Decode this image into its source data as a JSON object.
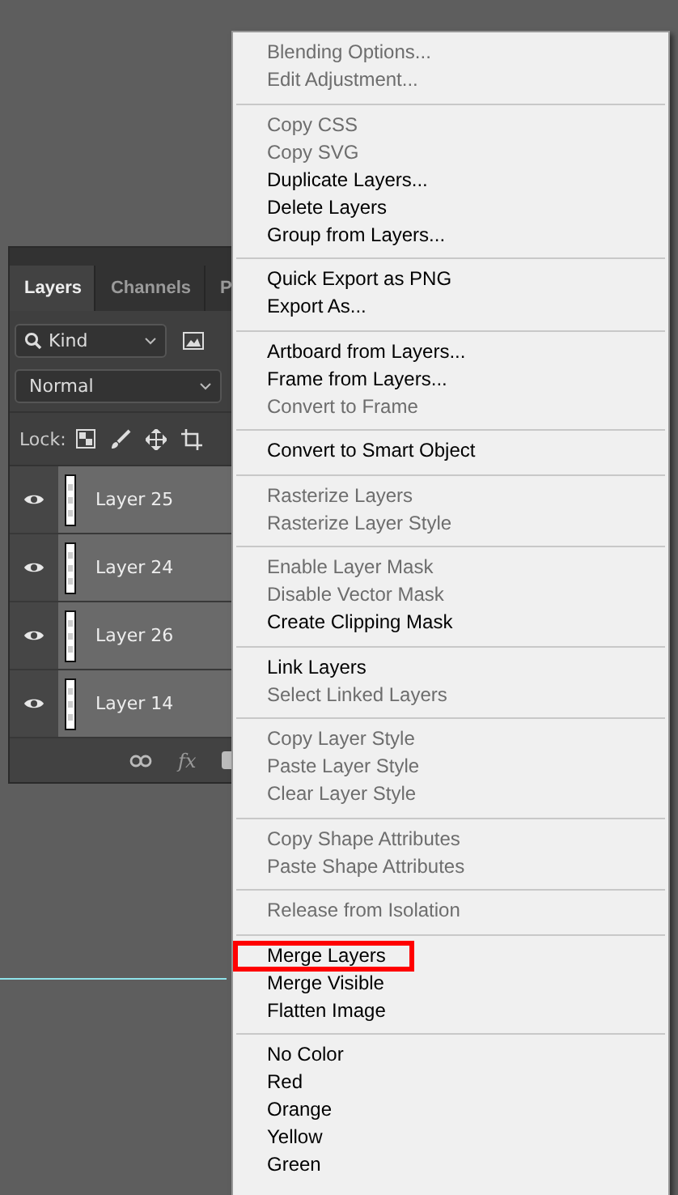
{
  "layers_panel": {
    "tabs": [
      {
        "label": "Layers",
        "selected": true
      },
      {
        "label": "Channels",
        "selected": false
      },
      {
        "label": "P",
        "selected": false
      }
    ],
    "filter": {
      "value": "Kind"
    },
    "blend_mode": {
      "value": "Normal"
    },
    "lock_label": "Lock:",
    "layers": [
      {
        "name": "Layer 25",
        "visible": true
      },
      {
        "name": "Layer 24",
        "visible": true
      },
      {
        "name": "Layer 26",
        "visible": true
      },
      {
        "name": "Layer 14",
        "visible": true
      }
    ],
    "footer_fx": "fx"
  },
  "context_menu": {
    "groups": [
      [
        {
          "label": "Blending Options...",
          "disabled": true,
          "outlined": false
        },
        {
          "label": "Edit Adjustment...",
          "disabled": true,
          "outlined": false
        }
      ],
      [
        {
          "label": "Copy CSS",
          "disabled": true,
          "outlined": false
        },
        {
          "label": "Copy SVG",
          "disabled": true,
          "outlined": false
        },
        {
          "label": "Duplicate Layers...",
          "disabled": false,
          "outlined": false
        },
        {
          "label": "Delete Layers",
          "disabled": false,
          "outlined": false
        },
        {
          "label": "Group from Layers...",
          "disabled": false,
          "outlined": false
        }
      ],
      [
        {
          "label": "Quick Export as PNG",
          "disabled": false,
          "outlined": false
        },
        {
          "label": "Export As...",
          "disabled": false,
          "outlined": false
        }
      ],
      [
        {
          "label": "Artboard from Layers...",
          "disabled": false,
          "outlined": false
        },
        {
          "label": "Frame from Layers...",
          "disabled": false,
          "outlined": false
        },
        {
          "label": "Convert to Frame",
          "disabled": true,
          "outlined": false
        }
      ],
      [
        {
          "label": "Convert to Smart Object",
          "disabled": false,
          "outlined": false
        }
      ],
      [
        {
          "label": "Rasterize Layers",
          "disabled": true,
          "outlined": false
        },
        {
          "label": "Rasterize Layer Style",
          "disabled": true,
          "outlined": false
        }
      ],
      [
        {
          "label": "Enable Layer Mask",
          "disabled": true,
          "outlined": false
        },
        {
          "label": "Disable Vector Mask",
          "disabled": true,
          "outlined": false
        },
        {
          "label": "Create Clipping Mask",
          "disabled": false,
          "outlined": false
        }
      ],
      [
        {
          "label": "Link Layers",
          "disabled": false,
          "outlined": false
        },
        {
          "label": "Select Linked Layers",
          "disabled": true,
          "outlined": false
        }
      ],
      [
        {
          "label": "Copy Layer Style",
          "disabled": true,
          "outlined": false
        },
        {
          "label": "Paste Layer Style",
          "disabled": true,
          "outlined": false
        },
        {
          "label": "Clear Layer Style",
          "disabled": true,
          "outlined": false
        }
      ],
      [
        {
          "label": "Copy Shape Attributes",
          "disabled": true,
          "outlined": false
        },
        {
          "label": "Paste Shape Attributes",
          "disabled": true,
          "outlined": false
        }
      ],
      [
        {
          "label": "Release from Isolation",
          "disabled": true,
          "outlined": false
        }
      ],
      [
        {
          "label": "Merge Layers",
          "disabled": false,
          "outlined": true
        },
        {
          "label": "Merge Visible",
          "disabled": false,
          "outlined": false
        },
        {
          "label": "Flatten Image",
          "disabled": false,
          "outlined": false
        }
      ],
      [
        {
          "label": "No Color",
          "disabled": false,
          "outlined": false
        },
        {
          "label": "Red",
          "disabled": false,
          "outlined": false
        },
        {
          "label": "Orange",
          "disabled": false,
          "outlined": false
        },
        {
          "label": "Yellow",
          "disabled": false,
          "outlined": false
        },
        {
          "label": "Green",
          "disabled": false,
          "outlined": false
        }
      ]
    ]
  }
}
